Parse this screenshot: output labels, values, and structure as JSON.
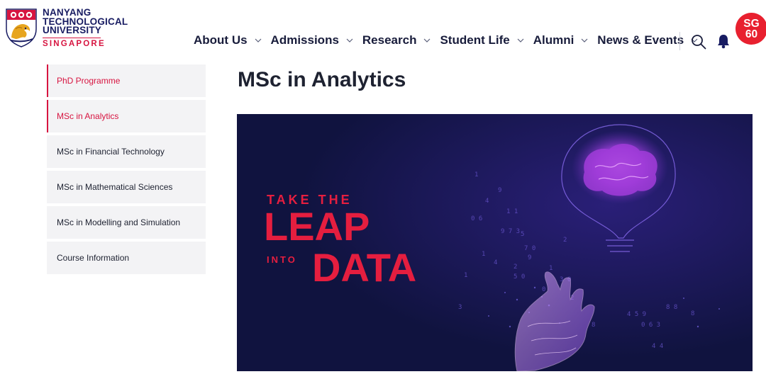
{
  "logo": {
    "line1": "NANYANG",
    "line2": "TECHNOLOGICAL",
    "line3": "UNIVERSITY",
    "line4": "SINGAPORE"
  },
  "nav": {
    "items": [
      {
        "label": "About Us"
      },
      {
        "label": "Admissions"
      },
      {
        "label": "Research"
      },
      {
        "label": "Student Life"
      },
      {
        "label": "Alumni"
      },
      {
        "label": "News & Events"
      }
    ],
    "icons": {
      "search": "search-icon",
      "notifications": "bell-icon",
      "chevron": "chevron-down-icon"
    }
  },
  "badge": {
    "line1": "SG",
    "line2": "60"
  },
  "sidebar": {
    "items": [
      {
        "label": "PhD Programme",
        "active": true
      },
      {
        "label": "MSc in Analytics",
        "active": true
      },
      {
        "label": "MSc in Financial Technology",
        "active": false
      },
      {
        "label": "MSc in Mathematical Sciences",
        "active": false
      },
      {
        "label": "MSc in Modelling and Simulation",
        "active": false
      },
      {
        "label": "Course Information",
        "active": false
      }
    ]
  },
  "page": {
    "title": "MSc in Analytics"
  },
  "hero": {
    "line1": "TAKE THE",
    "line2": "LEAP",
    "line3": "INTO",
    "line4": "DATA"
  },
  "colors": {
    "brand_red": "#d71440",
    "navy": "#181c62",
    "hero_bg": "#10133f",
    "sidebar_bg": "#f3f3f5",
    "badge_red": "#e8202f"
  }
}
